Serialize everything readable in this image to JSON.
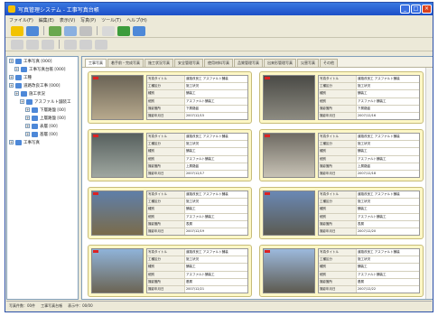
{
  "window": {
    "title": "写真管理システム - 工事写真台帳"
  },
  "menu": [
    "ファイル(F)",
    "編集(E)",
    "表示(V)",
    "写真(P)",
    "ツール(T)",
    "ヘルプ(H)"
  ],
  "left": {
    "tree": [
      {
        "label": "工事写真 [000]",
        "indent": 0
      },
      {
        "label": "工事写真台帳 [000]",
        "indent": 1
      },
      {
        "label": "工種",
        "indent": 0
      },
      {
        "label": "道路改良工事 [000]",
        "indent": 0
      },
      {
        "label": "施工状況",
        "indent": 1
      },
      {
        "label": "アスファルト舗装工",
        "indent": 2
      },
      {
        "label": "下層路盤 [00]",
        "indent": 3
      },
      {
        "label": "上層路盤 [00]",
        "indent": 3
      },
      {
        "label": "表層 [00]",
        "indent": 3
      },
      {
        "label": "基層 [00]",
        "indent": 3
      },
      {
        "label": "工事写真",
        "indent": 0
      }
    ]
  },
  "main": {
    "tabs": [
      "工事写真",
      "着手前・完成写真",
      "施工状況写真",
      "安全管理写真",
      "使用材料写真",
      "品質管理写真",
      "出来形管理写真",
      "災害写真",
      "その他"
    ],
    "info_labels": [
      "写真タイトル",
      "工種区分",
      "種別",
      "細別",
      "撮影箇所",
      "撮影年月日"
    ],
    "cards": [
      {
        "photo": [
          "#6b6456",
          "#b7a98d"
        ],
        "values": [
          "道路改良工 アスファルト舗装",
          "施工状況",
          "舗装工",
          "アスファルト舗装工",
          "下層路盤",
          "2007/12/15"
        ]
      },
      {
        "photo": [
          "#4a4a46",
          "#8c8a80"
        ],
        "values": [
          "道路改良工 アスファルト舗装",
          "施工状況",
          "舗装工",
          "アスファルト舗装工",
          "下層路盤",
          "2007/12/16"
        ]
      },
      {
        "photo": [
          "#57605e",
          "#9fa7a0"
        ],
        "values": [
          "道路改良工 アスファルト舗装",
          "施工状況",
          "舗装工",
          "アスファルト舗装工",
          "上層路盤",
          "2007/12/17"
        ]
      },
      {
        "photo": [
          "#6f6b63",
          "#c7c2b5"
        ],
        "values": [
          "道路改良工 アスファルト舗装",
          "施工状況",
          "舗装工",
          "アスファルト舗装工",
          "上層路盤",
          "2007/12/18"
        ]
      },
      {
        "photo": [
          "#5f7fa8",
          "#7a6b4a"
        ],
        "values": [
          "道路改良工 アスファルト舗装",
          "施工状況",
          "舗装工",
          "アスファルト舗装工",
          "表層",
          "2007/12/19"
        ]
      },
      {
        "photo": [
          "#6a88b4",
          "#5b5b52"
        ],
        "values": [
          "道路改良工 アスファルト舗装",
          "施工状況",
          "舗装工",
          "アスファルト舗装工",
          "表層",
          "2007/12/20"
        ]
      },
      {
        "photo": [
          "#8fb3d9",
          "#6b6453"
        ],
        "values": [
          "道路改良工 アスファルト舗装",
          "施工状況",
          "舗装工",
          "アスファルト舗装工",
          "基層",
          "2007/12/21"
        ]
      },
      {
        "photo": [
          "#9cb9dc",
          "#5d5a50"
        ],
        "values": [
          "道路改良工 アスファルト舗装",
          "施工状況",
          "舗装工",
          "アスファルト舗装工",
          "基層",
          "2007/12/22"
        ]
      }
    ]
  },
  "status": {
    "left": "写真件数：00件",
    "mid": "工事写真台帳",
    "right": "表示中：00/00"
  }
}
